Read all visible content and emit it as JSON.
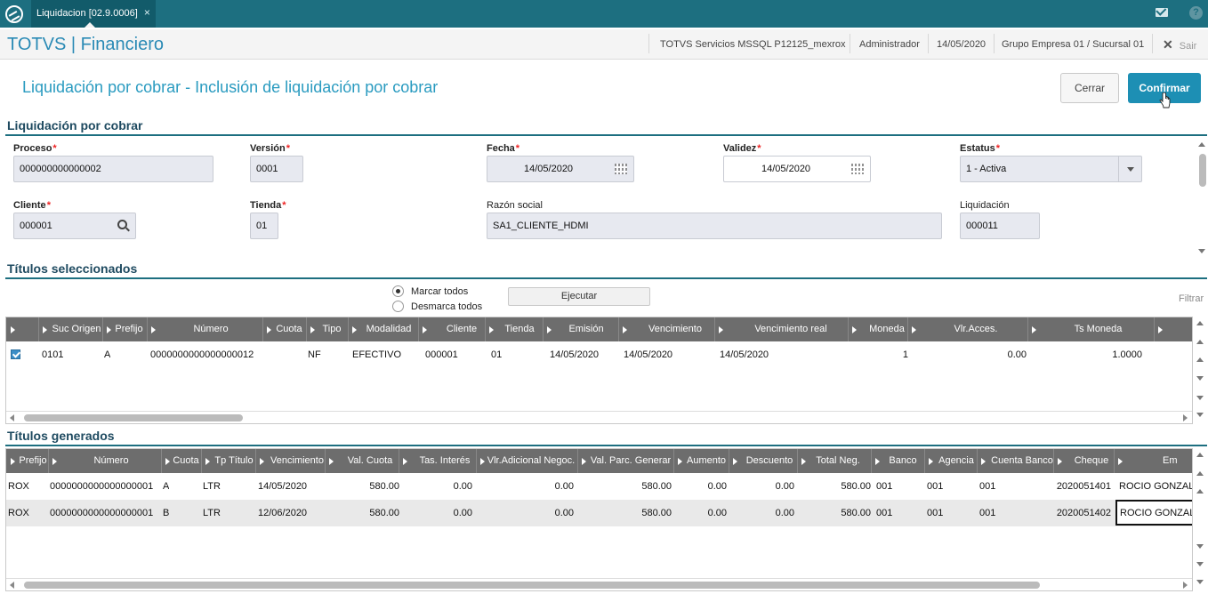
{
  "topbar": {
    "tab_label": "Liquidacion [02.9.0006]",
    "tab_close": "×"
  },
  "appbar": {
    "title": "TOTVS | Financiero",
    "server": "TOTVS Servicios MSSQL P12125_mexrox",
    "user": "Administrador",
    "date": "14/05/2020",
    "branch": "Grupo Empresa 01 / Sucursal 01",
    "exit": "Sair"
  },
  "page": {
    "title": "Liquidación por cobrar - Inclusión de liquidación por cobrar",
    "cancel_label": "Cerrar",
    "confirm_label": "Confirmar"
  },
  "form": {
    "section_title": "Liquidación por cobrar",
    "proceso": {
      "label": "Proceso",
      "value": "000000000000002"
    },
    "version": {
      "label": "Versión",
      "value": "0001"
    },
    "fecha": {
      "label": "Fecha",
      "value": "14/05/2020"
    },
    "validez": {
      "label": "Validez",
      "value": "14/05/2020"
    },
    "estatus": {
      "label": "Estatus",
      "value": "1 - Activa"
    },
    "cliente": {
      "label": "Cliente",
      "value": "000001"
    },
    "tienda": {
      "label": "Tienda",
      "value": "01"
    },
    "razon": {
      "label": "Razón social",
      "value": "SA1_CLIENTE_HDMI"
    },
    "liquidacion": {
      "label": "Liquidación",
      "value": "000011"
    },
    "required_mark": "*"
  },
  "selected": {
    "section_title": "Títulos seleccionados",
    "mark_all": "Marcar todos",
    "unmark_all": "Desmarca todos",
    "execute": "Ejecutar",
    "filter": "Filtrar",
    "columns": [
      "Suc Origen",
      "Prefijo",
      "Número",
      "Cuota",
      "Tipo",
      "Modalidad",
      "Cliente",
      "Tienda",
      "Emisión",
      "Vencimiento",
      "Vencimiento real",
      "Moneda",
      "Vlr.Acces.",
      "Ts Moneda"
    ],
    "rows": [
      {
        "checked": true,
        "cells": [
          "0101",
          "A",
          "0000000000000000012",
          "",
          "NF",
          "EFECTIVO",
          "000001",
          "01",
          "14/05/2020",
          "14/05/2020",
          "14/05/2020",
          "1",
          "0.00",
          "1.0000"
        ]
      }
    ]
  },
  "generated": {
    "section_title": "Títulos generados",
    "columns": [
      "Prefijo",
      "Número",
      "Cuota",
      "Tp Título",
      "Vencimiento",
      "Val. Cuota",
      "Tas. Interés",
      "Vlr.Adicional Negoc.",
      "Val. Parc. Generar",
      "Aumento",
      "Descuento",
      "Total Neg.",
      "Banco",
      "Agencia",
      "Cuenta Banco",
      "Cheque",
      "Em"
    ],
    "rows": [
      [
        "ROX",
        "0000000000000000001",
        "A",
        "LTR",
        "14/05/2020",
        "580.00",
        "0.00",
        "0.00",
        "580.00",
        "0.00",
        "0.00",
        "580.00",
        "001",
        "001",
        "001",
        "2020051401",
        "ROCIO GONZALEZ"
      ],
      [
        "ROX",
        "0000000000000000001",
        "B",
        "LTR",
        "12/06/2020",
        "580.00",
        "0.00",
        "0.00",
        "580.00",
        "0.00",
        "0.00",
        "580.00",
        "001",
        "001",
        "001",
        "2020051402",
        "ROCIO GONZALEZ"
      ]
    ]
  }
}
